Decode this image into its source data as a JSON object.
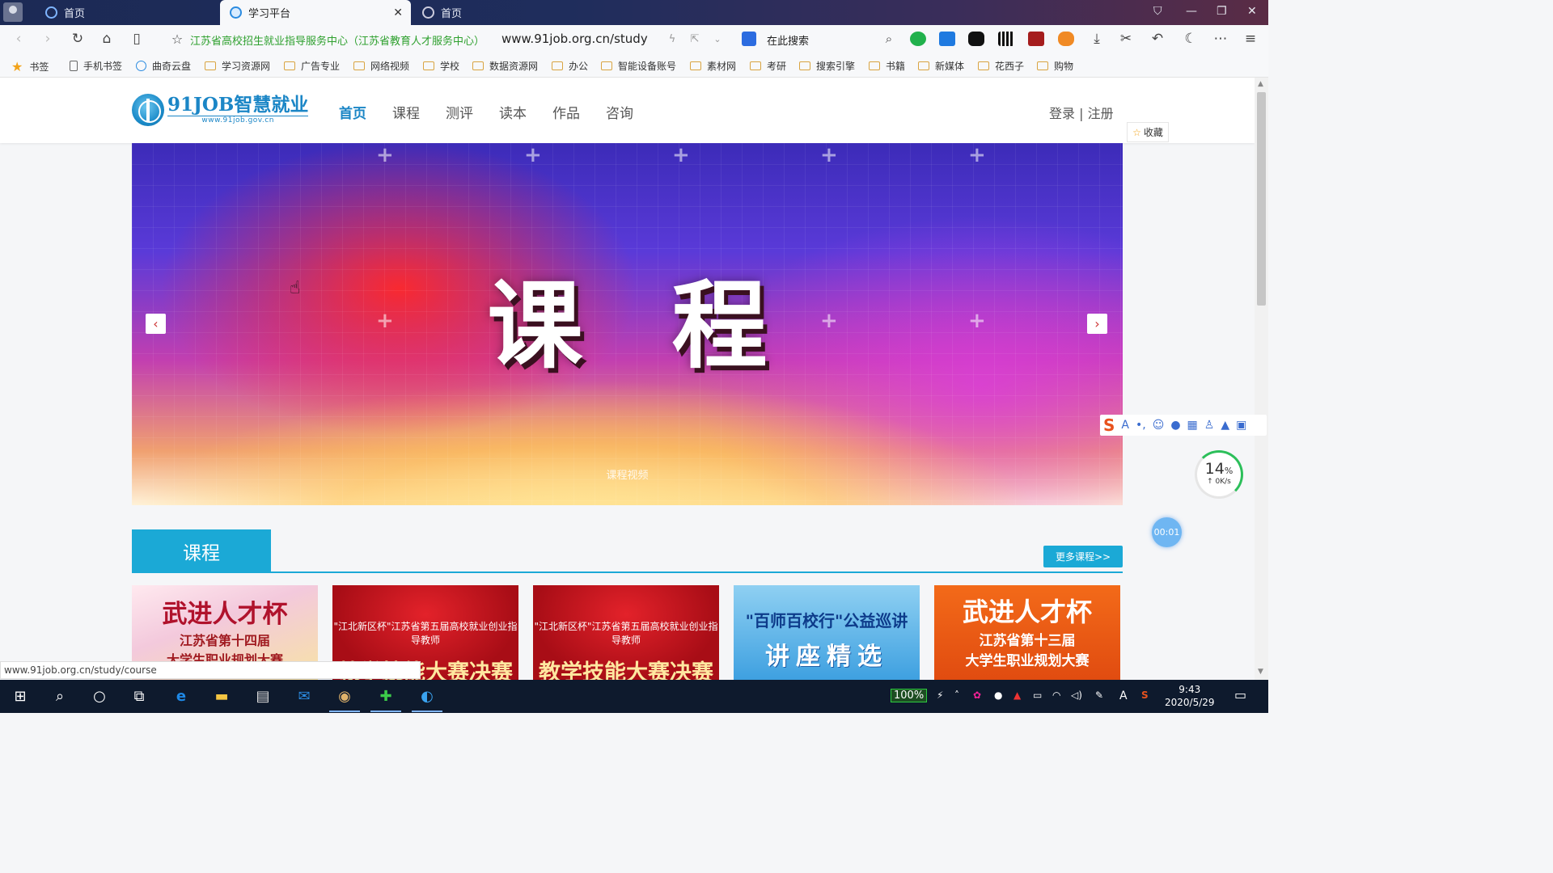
{
  "browser": {
    "tabs": [
      {
        "label": "首页",
        "active": false
      },
      {
        "label": "学习平台",
        "active": true
      },
      {
        "label": "首页",
        "active": false
      }
    ],
    "site_title": "江苏省高校招生就业指导服务中心（江苏省教育人才服务中心）",
    "url": "www.91job.org.cn/study",
    "search_placeholder": "在此搜索",
    "bookmarks": [
      "书签",
      "手机书签",
      "曲奇云盘",
      "学习资源网",
      "广告专业",
      "网络视频",
      "学校",
      "数据资源网",
      "办公",
      "智能设备账号",
      "素材网",
      "考研",
      "搜索引擎",
      "书籍",
      "新媒体",
      "花西子",
      "购物"
    ],
    "status_url": "www.91job.org.cn/study/course"
  },
  "site": {
    "logo_main": "91JOB智慧就业",
    "logo_sub": "www.91job.gov.cn",
    "nav": [
      "首页",
      "课程",
      "测评",
      "读本",
      "作品",
      "咨询"
    ],
    "auth_login": "登录",
    "auth_sep": "|",
    "auth_register": "注册",
    "favorite": "收藏"
  },
  "banner": {
    "title": "课程",
    "caption": "课程视频",
    "prev_icon": "‹",
    "next_icon": "›"
  },
  "courses": {
    "section_title": "课程",
    "more_label": "更多课程>>",
    "cards": [
      {
        "line1": "武进人才杯",
        "line2": "江苏省第十四届",
        "line3": "大学生职业规划大赛"
      },
      {
        "line1": "\"江北新区杯\"江苏省第五届高校就业创业指导教师",
        "line2": "教学技能大赛决赛"
      },
      {
        "line1": "\"江北新区杯\"江苏省第五届高校就业创业指导教师",
        "line2": "教学技能大赛决赛"
      },
      {
        "line1": "\"百师百校行\"公益巡讲",
        "line2": "讲座精选"
      },
      {
        "line1": "武进人才杯",
        "line2": "江苏省第十三届",
        "line3": "大学生职业规划大赛"
      }
    ]
  },
  "widgets": {
    "speed_pct": "14",
    "speed_unit": "%",
    "speed_rate": "↑ 0K/s",
    "timer": "00:01"
  },
  "taskbar": {
    "battery": "100%",
    "time": "9:43",
    "date": "2020/5/29",
    "ime_char": "A"
  }
}
